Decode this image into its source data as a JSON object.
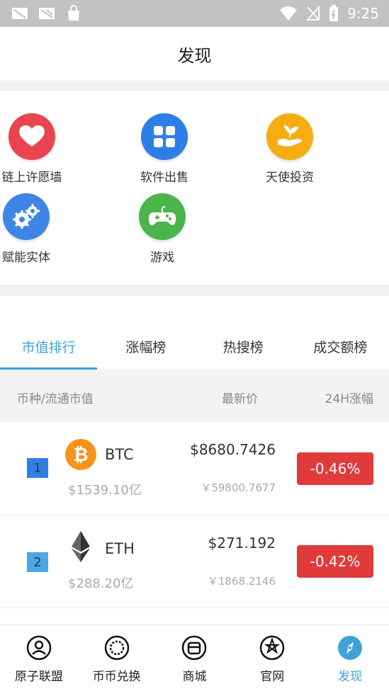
{
  "status_bar": {
    "time": "9:25"
  },
  "header": {
    "title": "发现"
  },
  "grid": [
    {
      "label": "链上许愿墙",
      "icon": "heart-icon",
      "color": "#e9444f"
    },
    {
      "label": "软件出售",
      "icon": "apps-grid-icon",
      "color": "#2f7ee8"
    },
    {
      "label": "天使投资",
      "icon": "hand-sprout-icon",
      "color": "#f5ad12"
    },
    {
      "label": "赋能实体",
      "icon": "gears-icon",
      "color": "#3d86e6"
    },
    {
      "label": "游戏",
      "icon": "gamepad-icon",
      "color": "#4ab54a"
    }
  ],
  "tabs": [
    {
      "label": "市值排行",
      "active": true
    },
    {
      "label": "涨幅榜",
      "active": false
    },
    {
      "label": "热搜榜",
      "active": false
    },
    {
      "label": "成交额榜",
      "active": false
    }
  ],
  "columns": {
    "coin": "币种/流通市值",
    "price": "最新价",
    "change": "24H涨幅"
  },
  "rows": [
    {
      "rank": "1",
      "symbol": "BTC",
      "market_cap": "$1539.10亿",
      "price_usd": "$8680.7426",
      "price_cny": "￥59800.7677",
      "change": "-0.46%",
      "icon": "bitcoin-icon"
    },
    {
      "rank": "2",
      "symbol": "ETH",
      "market_cap": "$288.20亿",
      "price_usd": "$271.192",
      "price_cny": "￥1868.2146",
      "change": "-0.42%",
      "icon": "ethereum-icon"
    }
  ],
  "nav": [
    {
      "label": "原子联盟",
      "icon": "person-icon",
      "active": false
    },
    {
      "label": "币币兑换",
      "icon": "exchange-icon",
      "active": false
    },
    {
      "label": "商城",
      "icon": "shop-icon",
      "active": false
    },
    {
      "label": "官网",
      "icon": "website-icon",
      "active": false
    },
    {
      "label": "发现",
      "icon": "compass-icon",
      "active": true
    }
  ],
  "colors": {
    "accent": "#3fa3d8",
    "down": "#e03a3a"
  }
}
